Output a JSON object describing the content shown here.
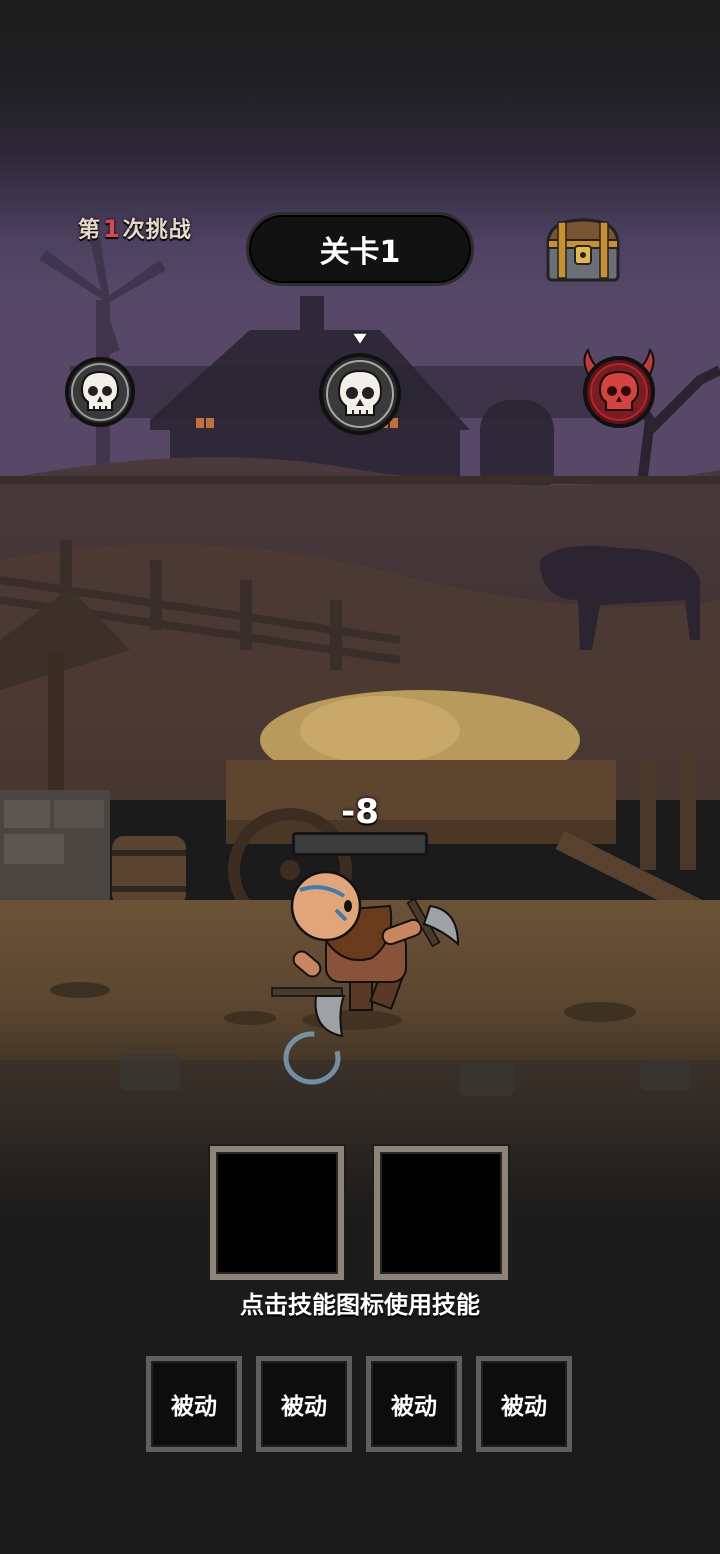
{
  "header": {
    "attempt_prefix": "第",
    "attempt_number": "1",
    "attempt_suffix": "次挑战",
    "level_title": "关卡1"
  },
  "progress": {
    "nodes": [
      {
        "type": "skull",
        "icon": "skull-icon"
      },
      {
        "type": "skull",
        "icon": "skull-icon",
        "current": true
      },
      {
        "type": "boss",
        "icon": "demon-skull-icon"
      }
    ]
  },
  "combat": {
    "damage_text": "-8",
    "hp_fraction": 0
  },
  "skills": {
    "slots": 2,
    "hint": "点击技能图标使用技能"
  },
  "passives": [
    {
      "label": "被动"
    },
    {
      "label": "被动"
    },
    {
      "label": "被动"
    },
    {
      "label": "被动"
    }
  ],
  "colors": {
    "attempt_number": "#e0474c",
    "attempt_text": "#e6d9c6",
    "boss_node": "#b5262b"
  }
}
